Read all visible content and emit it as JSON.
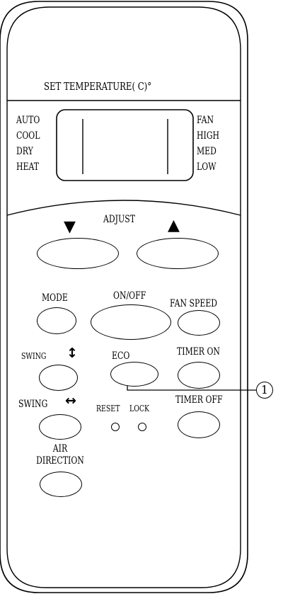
{
  "display": {
    "set_temperature": "SET TEMPERATURE( C)°",
    "modes": [
      "AUTO",
      "COOL",
      "DRY",
      "HEAT"
    ],
    "fan_speeds": [
      "FAN",
      "HIGH",
      "MED",
      "LOW"
    ]
  },
  "adjust": {
    "label": "ADJUST",
    "down_icon": "down-triangle-icon",
    "up_icon": "up-triangle-icon"
  },
  "buttons": {
    "mode": "MODE",
    "on_off": "ON/OFF",
    "fan_speed": "FAN SPEED",
    "swing_vertical": "SWING",
    "swing_vertical_icon": "vertical-double-arrow-icon",
    "eco": "ECO",
    "timer_on": "TIMER ON",
    "swing_horizontal": "SWING",
    "swing_horizontal_icon": "horizontal-double-arrow-icon",
    "reset": "RESET",
    "lock": "LOCK",
    "timer_off": "TIMER OFF",
    "air_direction_line1": "AIR",
    "air_direction_line2": "DIRECTION"
  },
  "callout": {
    "number": "1"
  }
}
